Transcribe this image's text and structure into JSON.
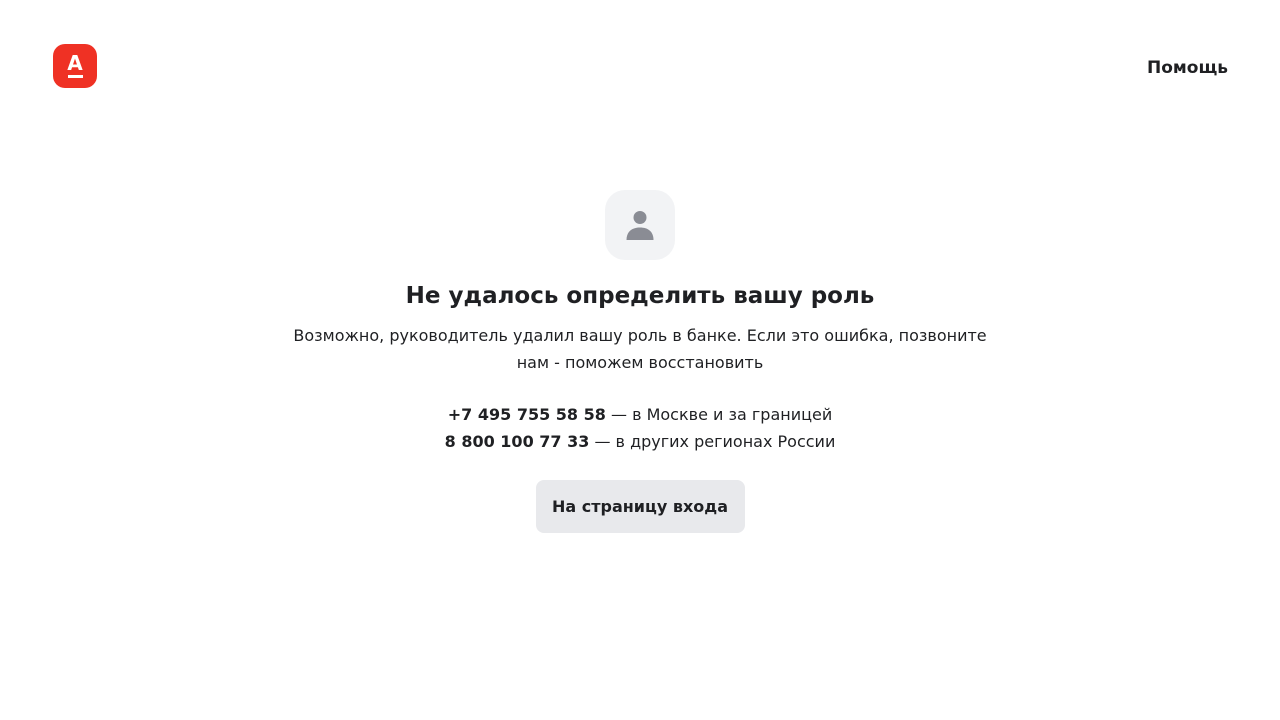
{
  "header": {
    "logo_letter": "А",
    "help_label": "Помощь"
  },
  "colors": {
    "brand": "#ef3124",
    "icon_box_bg": "#f2f3f5",
    "icon_fg": "#8a8c94",
    "button_bg": "#e8e9ec",
    "text": "#1f2023"
  },
  "error": {
    "icon": "user-icon",
    "title": "Не удалось определить вашу роль",
    "description": "Возможно, руководитель удалил вашу роль в банке. Если это ошибка, позвоните нам - поможем восстановить"
  },
  "contacts": [
    {
      "number": "+7 495 755 58 58",
      "note": " — в Москве и за границей"
    },
    {
      "number": "8 800 100 77 33",
      "note": " — в других регионах России"
    }
  ],
  "actions": {
    "login_label": "На страницу входа"
  }
}
